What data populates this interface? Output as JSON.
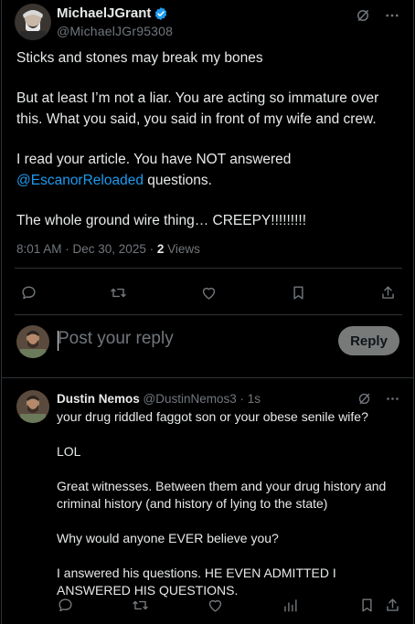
{
  "main_tweet": {
    "display_name": "MichaelJGrant",
    "handle": "@MichaelJGr95308",
    "paragraphs": [
      "Sticks and stones may break my bones",
      "But at least I’m not a liar. You are acting so immature over this. What you said, you said in front of my wife and crew."
    ],
    "para3_text": "I read your article. You have NOT answered ",
    "para3_mention": "@EscanorReloaded",
    "para3_tail": " questions.",
    "para4": "The whole ground wire thing… CREEPY!!!!!!!!!",
    "timestamp": "8:01 AM · Dec 30, 2025 · ",
    "views_count": "2",
    "views_label": " Views"
  },
  "composer": {
    "placeholder": "Post your reply",
    "reply_label": "Reply"
  },
  "reply_tweet": {
    "display_name": "Dustin Nemos",
    "handle_time": " @DustinNemos3 · 1s",
    "paragraphs": [
      "your drug riddled faggot son or your obese senile wife?",
      "LOL",
      "Great witnesses. Between them and your drug history and criminal history (and history of lying to the state)",
      "Why would anyone EVER believe you?",
      "I answered his questions. HE EVEN ADMITTED I ANSWERED HIS QUESTIONS."
    ]
  },
  "colors": {
    "background": "#000000",
    "text": "#e7e9ea",
    "muted": "#71767b",
    "accent": "#1d9bf0",
    "reply_button": "#787a7a"
  },
  "icons": [
    "verified-badge-icon",
    "grok-icon",
    "more-icon",
    "reply-icon",
    "retweet-icon",
    "like-icon",
    "bookmark-icon",
    "share-icon",
    "analytics-icon"
  ]
}
